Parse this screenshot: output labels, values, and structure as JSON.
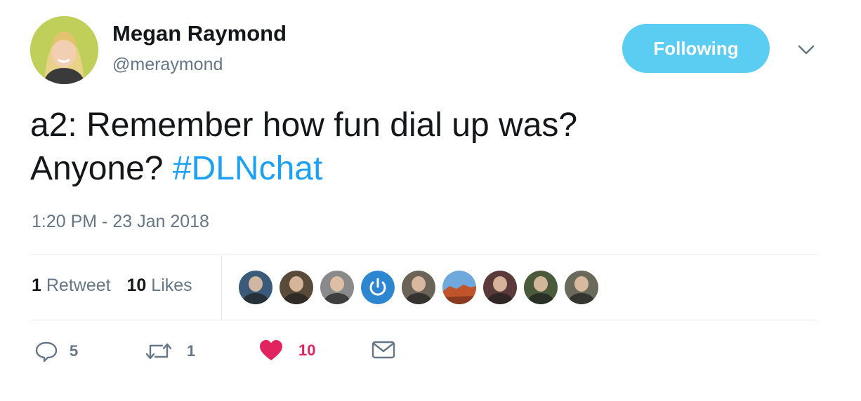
{
  "author": {
    "name": "Megan Raymond",
    "handle": "@meraymond"
  },
  "follow_button": {
    "label": "Following"
  },
  "tweet": {
    "text_line1": "a2: Remember how fun dial up was?",
    "text_line2": "Anyone?",
    "hashtag": "#DLNchat",
    "timestamp": "1:20 PM - 23 Jan 2018"
  },
  "stats": {
    "retweets_count": "1",
    "retweets_label": "Retweet",
    "likes_count": "10",
    "likes_label": "Likes"
  },
  "likers": [
    {
      "name": "liker-1",
      "color": "#3b5a7a"
    },
    {
      "name": "liker-2",
      "color": "#5a4a3a"
    },
    {
      "name": "liker-3",
      "color": "#8a8a8a"
    },
    {
      "name": "liker-4",
      "color": "#2d86d0"
    },
    {
      "name": "liker-5",
      "color": "#6b6258"
    },
    {
      "name": "liker-6",
      "color": "#c0542a"
    },
    {
      "name": "liker-7",
      "color": "#5a3a3a"
    },
    {
      "name": "liker-8",
      "color": "#4a5a3a"
    },
    {
      "name": "liker-9",
      "color": "#6a6a5a"
    }
  ],
  "actions": {
    "reply_count": "5",
    "retweet_count": "1",
    "like_count": "10"
  },
  "colors": {
    "accent": "#1da1f2",
    "follow_bg": "#5ccdf2",
    "like": "#e0245e",
    "muted": "#657786"
  }
}
